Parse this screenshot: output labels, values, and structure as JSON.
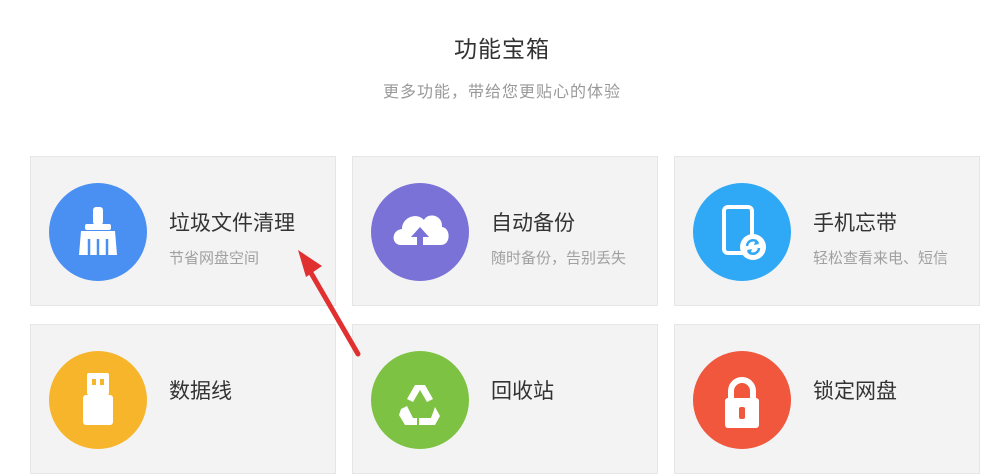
{
  "header": {
    "title": "功能宝箱",
    "subtitle": "更多功能，带给您更贴心的体验"
  },
  "cards": [
    {
      "title": "垃圾文件清理",
      "desc": "节省网盘空间",
      "color": "#4a8ff2",
      "icon": "broom-icon"
    },
    {
      "title": "自动备份",
      "desc": "随时备份，告别丢失",
      "color": "#7a72d6",
      "icon": "cloud-upload-icon"
    },
    {
      "title": "手机忘带",
      "desc": "轻松查看来电、短信",
      "color": "#2fa8f5",
      "icon": "phone-sync-icon"
    },
    {
      "title": "数据线",
      "desc": "",
      "color": "#f7b52c",
      "icon": "usb-cable-icon"
    },
    {
      "title": "回收站",
      "desc": "",
      "color": "#7dc242",
      "icon": "recycle-icon"
    },
    {
      "title": "锁定网盘",
      "desc": "",
      "color": "#f0573c",
      "icon": "lock-icon"
    }
  ],
  "annotation": {
    "arrow_color": "#e03030"
  }
}
